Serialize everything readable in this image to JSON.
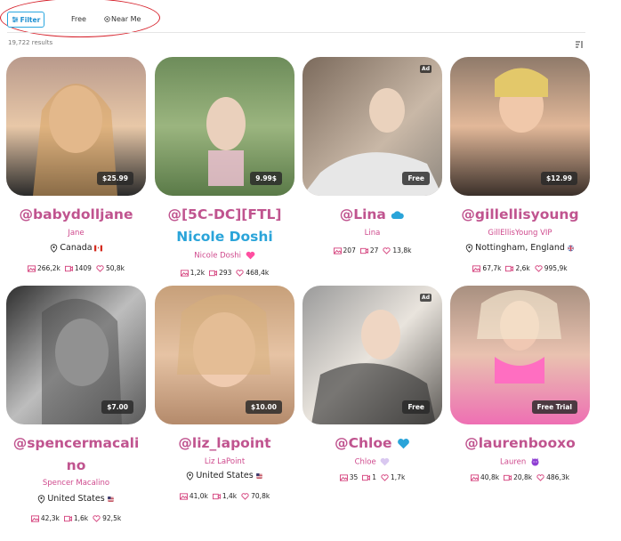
{
  "topbar": {
    "filter_label": "Filter",
    "free_label": "Free",
    "near_me_label": "Near Me"
  },
  "results_text": "19,722 results",
  "colors": {
    "accent": "#2aa4d9",
    "name_pink": "#cf4a8d",
    "stat_pink": "#d43f7b",
    "annotation_red": "#d6202a"
  },
  "cards": [
    {
      "handle": "@babydolljane",
      "name": "Jane",
      "location": "Canada",
      "flag": "canada-flag-icon",
      "price": "$25.99",
      "ad": "",
      "photos": "266,2k",
      "videos": "1409",
      "likes": "50,8k"
    },
    {
      "handle_line1": "@[5C-DC][FTL]",
      "handle_line2": "Nicole Doshi",
      "name": "Nicole Doshi",
      "badge": "heart-icon",
      "price": "9.99$",
      "ad": "",
      "photos": "1,2k",
      "videos": "293",
      "likes": "468,4k"
    },
    {
      "handle": "@Lina",
      "badge": "cloud-icon",
      "name": "Lina",
      "price": "Free",
      "ad": "Ad",
      "photos": "207",
      "videos": "27",
      "likes": "13,8k"
    },
    {
      "handle": "@gillellisyoung",
      "name": "GillEllisYoung VIP",
      "location": "Nottingham, England",
      "flag": "uk-flag-icon",
      "price": "$12.99",
      "ad": "",
      "photos": "67,7k",
      "videos": "2,6k",
      "likes": "995,9k"
    },
    {
      "handle_line1": "@spencermacali",
      "handle_line2": "no",
      "name": "Spencer Macalino",
      "location": "United States",
      "flag": "us-flag-icon",
      "price": "$7.00",
      "ad": "",
      "photos": "42,3k",
      "videos": "1,6k",
      "likes": "92,5k"
    },
    {
      "handle": "@liz_lapoint",
      "name": "Liz LaPoint",
      "location": "United States",
      "flag": "us-flag-icon",
      "price": "$10.00",
      "ad": "",
      "photos": "41,0k",
      "videos": "1,4k",
      "likes": "70,8k"
    },
    {
      "handle": "@Chloe",
      "badge": "blue-heart-icon",
      "name": "Chloe",
      "name_badge": "heart-icon",
      "price": "Free",
      "ad": "Ad",
      "photos": "35",
      "videos": "1",
      "likes": "1,7k"
    },
    {
      "handle": "@laurenbooxo",
      "name": "Lauren",
      "name_badge": "devil-icon",
      "price": "Free Trial",
      "ad": "",
      "photos": "40,8k",
      "videos": "20,8k",
      "likes": "486,3k"
    }
  ]
}
